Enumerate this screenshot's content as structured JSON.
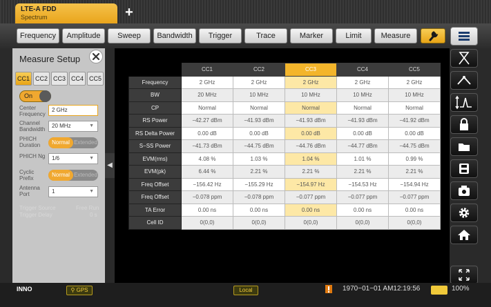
{
  "tabs": {
    "active_title": "LTE-A FDD",
    "active_subtitle": "Spectrum",
    "add_label": "+"
  },
  "toolbar": {
    "buttons": [
      "Frequency",
      "Amplitude",
      "Sweep",
      "Bandwidth",
      "Trigger",
      "Trace",
      "Marker",
      "Limit",
      "Measure"
    ]
  },
  "measure_setup": {
    "title": "Measure Setup",
    "cc_tabs": [
      "CC1",
      "CC2",
      "CC3",
      "CC4",
      "CC5"
    ],
    "active_cc": "CC1",
    "toggle": "On",
    "center_frequency_label": "Center Frequency",
    "center_frequency_value": "2 GHz",
    "channel_bandwidth_label": "Channel Bandwidth",
    "channel_bandwidth_value": "20 MHz",
    "phich_duration_label": "PHICH Duration",
    "phich_duration_on": "Normal",
    "phich_duration_off": "Extended",
    "phich_ng_label": "PHICH Ng",
    "phich_ng_value": "1/6",
    "cyclic_prefix_label": "Cyclic Prefix",
    "cyclic_prefix_on": "Normal",
    "cyclic_prefix_off": "Extended",
    "antenna_port_label": "Antenna Port",
    "antenna_port_value": "1",
    "trigger_source_label": "Trigger Source",
    "trigger_source_value": "Free Run",
    "trigger_delay_label": "Trigger Delay",
    "trigger_delay_value": "0 s"
  },
  "table": {
    "columns": [
      "CC1",
      "CC2",
      "CC3",
      "CC4",
      "CC5"
    ],
    "highlight_column": "CC3",
    "rows": [
      {
        "label": "Frequency",
        "values": [
          "2 GHz",
          "2 GHz",
          "2 GHz",
          "2 GHz",
          "2 GHz"
        ]
      },
      {
        "label": "BW",
        "values": [
          "20 MHz",
          "10 MHz",
          "10 MHz",
          "10 MHz",
          "10 MHz"
        ]
      },
      {
        "label": "CP",
        "values": [
          "Normal",
          "Normal",
          "Normal",
          "Normal",
          "Normal"
        ]
      },
      {
        "label": "RS Power",
        "values": [
          "−42.27 dBm",
          "−41.93 dBm",
          "−41.93 dBm",
          "−41.93 dBm",
          "−41.92 dBm"
        ]
      },
      {
        "label": "RS Delta Power",
        "values": [
          "0.00 dB",
          "0.00 dB",
          "0.00 dB",
          "0.00 dB",
          "0.00 dB"
        ]
      },
      {
        "label": "S−SS Power",
        "values": [
          "−41.73 dBm",
          "−44.75 dBm",
          "−44.76 dBm",
          "−44.77 dBm",
          "−44.75 dBm"
        ]
      },
      {
        "label": "EVM(rms)",
        "values": [
          "4.08 %",
          "1.03 %",
          "1.04 %",
          "1.01 %",
          "0.99 %"
        ]
      },
      {
        "label": "EVM(pk)",
        "values": [
          "6.44 %",
          "2.21 %",
          "2.21 %",
          "2.21 %",
          "2.21 %"
        ]
      },
      {
        "label": "Freq Offset",
        "values": [
          "−156.42 Hz",
          "−155.29 Hz",
          "−154.97 Hz",
          "−154.53 Hz",
          "−154.94 Hz"
        ]
      },
      {
        "label": "Freq Offset",
        "values": [
          "−0.078 ppm",
          "−0.078 ppm",
          "−0.077 ppm",
          "−0.077 ppm",
          "−0.077 ppm"
        ]
      },
      {
        "label": "TA Error",
        "values": [
          "0.00 ns",
          "0.00 ns",
          "0.00 ns",
          "0.00 ns",
          "0.00 ns"
        ]
      },
      {
        "label": "Cell ID",
        "values": [
          "0(0,0)",
          "0(0,0)",
          "0(0,0)",
          "0(0,0)",
          "0(0,0)"
        ]
      }
    ]
  },
  "right_icons": [
    "marker-icon",
    "peak-icon",
    "scale-icon",
    "lock-icon",
    "folder-icon",
    "save-icon",
    "camera-icon",
    "gear-icon",
    "home-icon",
    "expand-icon"
  ],
  "status": {
    "brand": "INNO",
    "gps": "GPS",
    "local": "Local",
    "datetime": "1970−01−01  AM12:19:56",
    "battery": "100%"
  },
  "colors": {
    "accent": "#e9a51c",
    "highlight_column_bg": "#fde8a6",
    "panel_bg": "#c6c6c6"
  }
}
